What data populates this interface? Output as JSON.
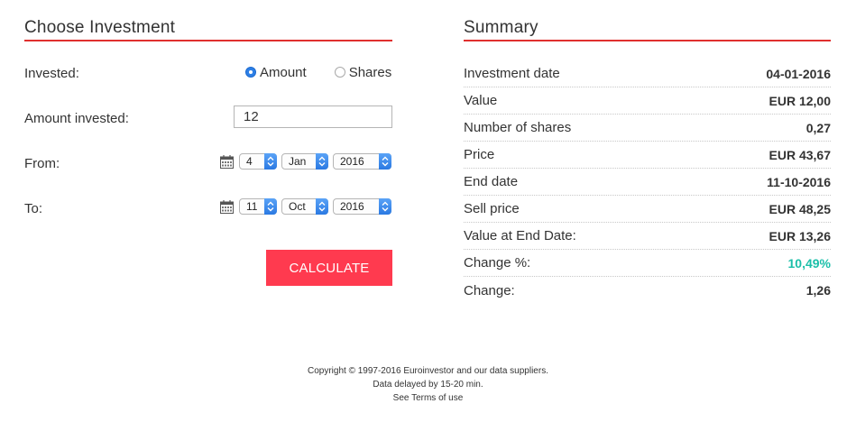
{
  "left": {
    "title": "Choose Investment",
    "invested_label": "Invested:",
    "radio_amount": "Amount",
    "radio_shares": "Shares",
    "radio_selected": "Amount",
    "amount_label": "Amount invested:",
    "amount_value": "12",
    "from_label": "From:",
    "from": {
      "day": "4",
      "month": "Jan",
      "year": "2016"
    },
    "to_label": "To:",
    "to": {
      "day": "11",
      "month": "Oct",
      "year": "2016"
    },
    "calculate_label": "CALCULATE"
  },
  "summary": {
    "title": "Summary",
    "rows": [
      {
        "label": "Investment date",
        "value": "04-01-2016"
      },
      {
        "label": "Value",
        "value": "EUR 12,00"
      },
      {
        "label": "Number of shares",
        "value": "0,27"
      },
      {
        "label": "Price",
        "value": "EUR 43,67"
      },
      {
        "label": "End date",
        "value": "11-10-2016"
      },
      {
        "label": "Sell price",
        "value": "EUR 48,25"
      },
      {
        "label": "Value at End Date:",
        "value": "EUR 13,26"
      },
      {
        "label": "Change %:",
        "value": "10,49%"
      },
      {
        "label": "Change:",
        "value": "1,26"
      }
    ]
  },
  "colors": {
    "accent_red": "#e0302f",
    "button": "#ff3a4f",
    "positive": "#1bbfa9"
  },
  "icons": {
    "calendar": "calendar-icon",
    "select_arrows": "select-arrows-icon"
  },
  "footer": {
    "line1": "Copyright © 1997-2016 Euroinvestor and our data suppliers.",
    "line2": "Data delayed by 15-20 min.",
    "line3": "See Terms of use"
  }
}
